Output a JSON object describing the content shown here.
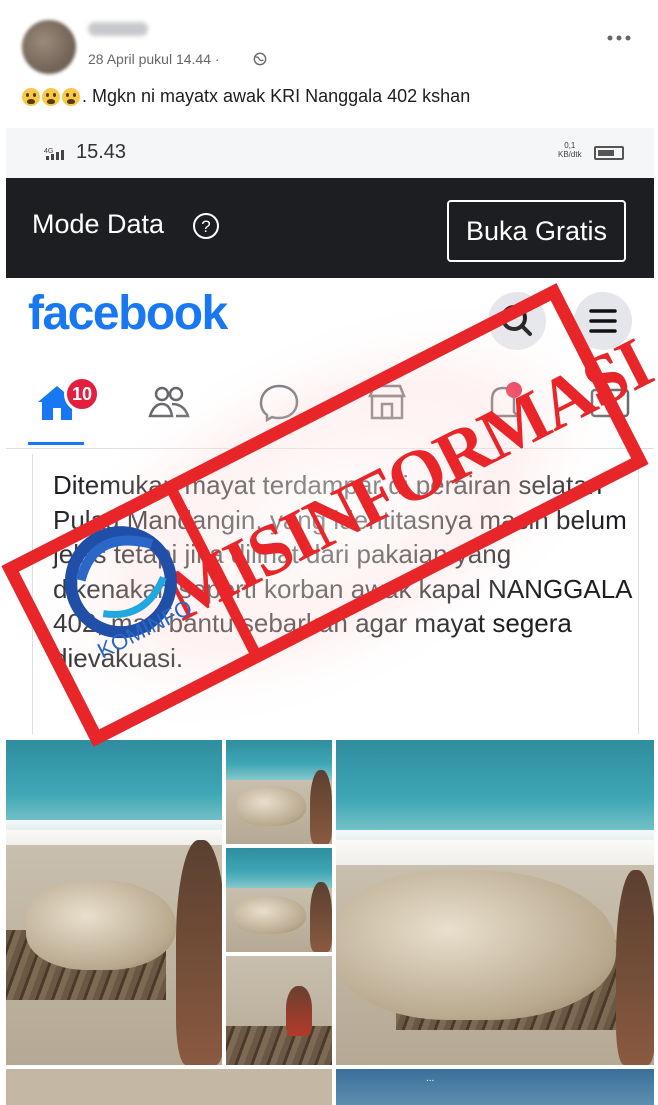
{
  "post": {
    "date": "28 April pukul 14.44 ·",
    "caption": ". Mgkn ni mayatx awak KRI Nanggala 402 kshan",
    "emojis": [
      "crying-face",
      "crying-face",
      "crying-face"
    ]
  },
  "status_bar": {
    "network": "4G",
    "time": "15.43",
    "speed_value": "0,1",
    "speed_unit": "KB/dtk"
  },
  "data_bar": {
    "label": "Mode Data",
    "button": "Buka Gratis"
  },
  "facebook": {
    "logo": "facebook",
    "notification_count": "10",
    "post_text": "Ditemukan mayat terdampar di perairan selatan Pulau Mandangin, yang identitasnya masih belum jelas tetapi jika dilihat dari pakaian yang dikenakan seperti korban awak kapal NANGGALA 402, mari bantu sebarkan agar mayat segera dievakuasi."
  },
  "stamp": {
    "text": "MISINFORMASI",
    "logo_text": "KOMINFO",
    "color": "#e8262a"
  },
  "photos": {
    "caption_bottom": "..."
  },
  "colors": {
    "facebook_blue": "#1877f2",
    "dark_bar": "#1c1e21",
    "badge_red": "#e41e3f"
  }
}
